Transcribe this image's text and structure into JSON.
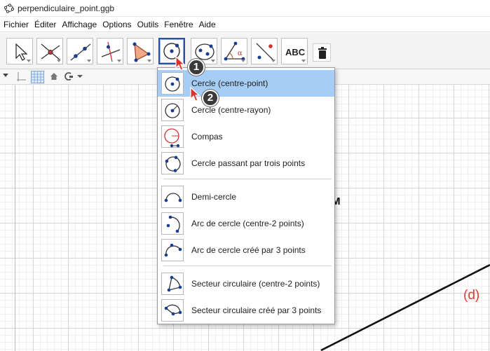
{
  "window": {
    "title": "perpendiculaire_point.ggb"
  },
  "menu": [
    "Fichier",
    "Éditer",
    "Affichage",
    "Options",
    "Outils",
    "Fenêtre",
    "Aide"
  ],
  "toolbar": {
    "tools": [
      {
        "name": "move-tool",
        "icon": "arrow-pointer-icon"
      },
      {
        "name": "point-tool",
        "icon": "intersect-point-icon"
      },
      {
        "name": "line-tool",
        "icon": "line-through-points-icon"
      },
      {
        "name": "perpendicular-tool",
        "icon": "perpendicular-line-icon"
      },
      {
        "name": "polygon-tool",
        "icon": "polygon-icon"
      },
      {
        "name": "circle-tool",
        "icon": "circle-center-point-icon",
        "active": true
      },
      {
        "name": "conic-tool",
        "icon": "ellipse-icon"
      },
      {
        "name": "angle-tool",
        "icon": "angle-icon",
        "glyph": "α"
      },
      {
        "name": "reflect-tool",
        "icon": "reflect-icon"
      },
      {
        "name": "text-tool",
        "icon": "text-icon",
        "glyph": "ABC"
      }
    ],
    "trash_icon": "trash-icon"
  },
  "dropdown": {
    "items": [
      {
        "label": "Cercle (centre-point)",
        "icon": "circle-center-point-icon",
        "selected": true
      },
      {
        "label": "Cercle (centre-rayon)",
        "icon": "circle-center-radius-icon"
      },
      {
        "label": "Compas",
        "icon": "compass-icon"
      },
      {
        "label": "Cercle passant par trois points",
        "icon": "circle-three-points-icon"
      },
      {
        "label": "Demi-cercle",
        "icon": "semicircle-icon"
      },
      {
        "label": "Arc de cercle (centre-2 points)",
        "icon": "arc-center-two-points-icon"
      },
      {
        "label": "Arc de cercle créé par 3 points",
        "icon": "arc-three-points-icon"
      },
      {
        "label": "Secteur circulaire (centre-2 points)",
        "icon": "sector-center-two-points-icon"
      },
      {
        "label": "Secteur circulaire créé par 3 points",
        "icon": "sector-three-points-icon"
      }
    ]
  },
  "canvas": {
    "label_m": "M",
    "label_d": "(d)"
  },
  "steps": {
    "step1": "1",
    "step2": "2"
  },
  "colors": {
    "accent": "#2c4f9e",
    "selected": "#a6cdf5",
    "point": "#1a3c8f",
    "line_label": "#e03a2f"
  }
}
